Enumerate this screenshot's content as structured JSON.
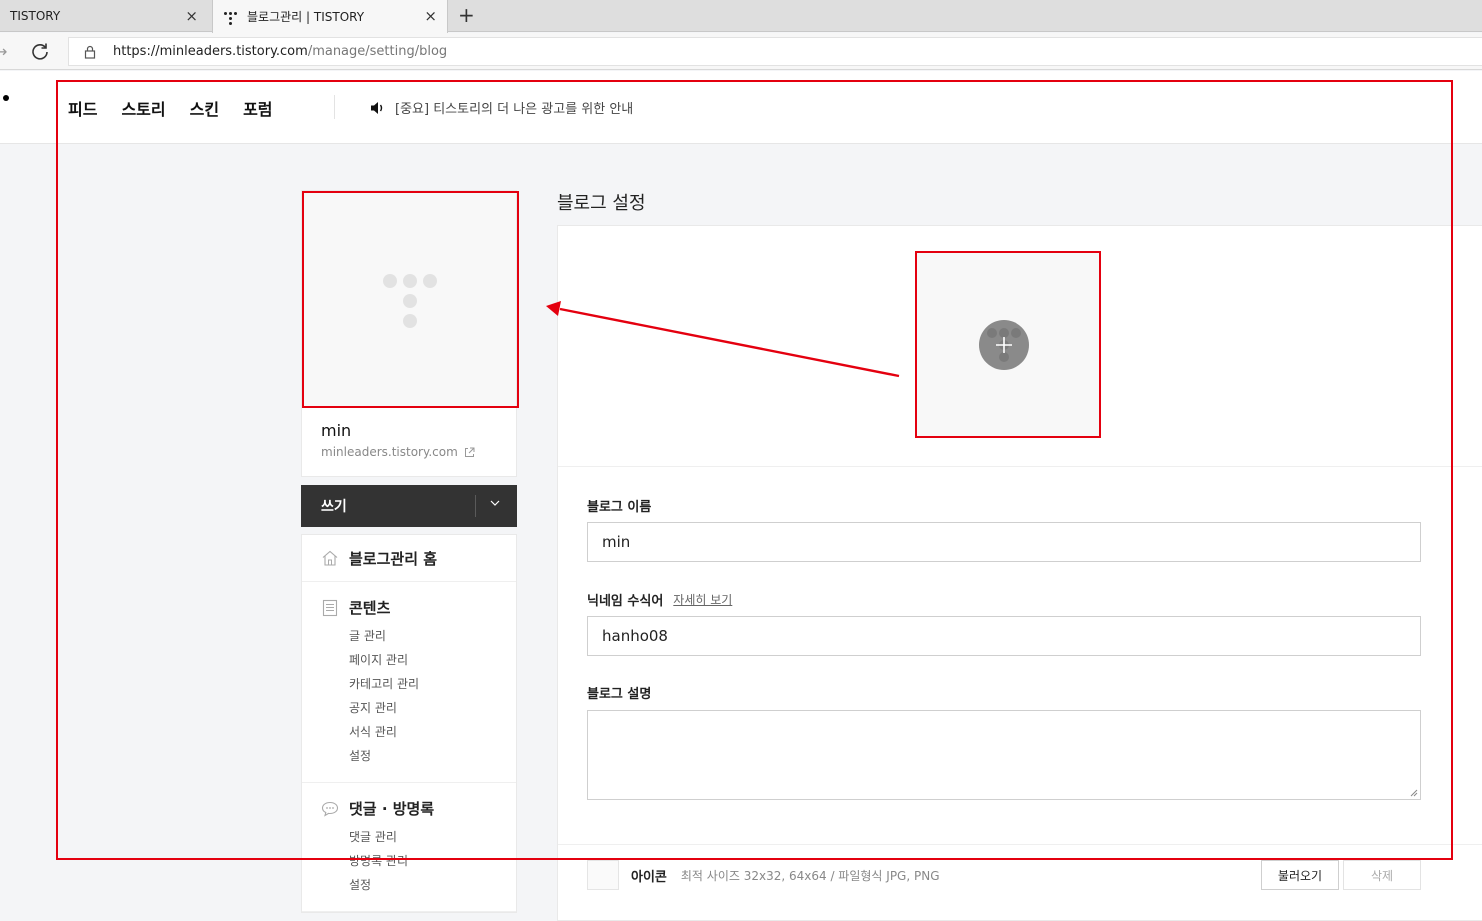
{
  "browser": {
    "tabs": [
      {
        "label": "TISTORY",
        "close": "×"
      },
      {
        "label": "블로그관리 | TISTORY",
        "close": "×"
      }
    ],
    "new_tab": "+",
    "url_host": "https://minleaders.tistory.com",
    "url_path": "/manage/setting/blog"
  },
  "nav": {
    "links": [
      "피드",
      "스토리",
      "스킨",
      "포럼"
    ],
    "notice": "[중요] 티스토리의 더 나은 광고를 위한 안내"
  },
  "sidebar": {
    "blog_name": "min",
    "blog_url": "minleaders.tistory.com",
    "write_label": "쓰기",
    "home_label": "블로그관리 홈",
    "contents": {
      "title": "콘텐츠",
      "items": [
        "글 관리",
        "페이지 관리",
        "카테고리 관리",
        "공지 관리",
        "서식 관리",
        "설정"
      ]
    },
    "comments": {
      "title": "댓글 · 방명록",
      "items": [
        "댓글 관리",
        "방명록 관리",
        "설정"
      ]
    }
  },
  "main": {
    "title": "블로그 설정",
    "blog_name_label": "블로그 이름",
    "blog_name_value": "min",
    "nickname_label": "닉네임 수식어",
    "nickname_more": "자세히 보기",
    "nickname_value": "hanho08",
    "description_label": "블로그 설명",
    "description_value": "",
    "icon_label": "아이콘",
    "icon_hint": "최적 사이즈 32x32, 64x64 / 파일형식 JPG, PNG",
    "load_button": "불러오기",
    "delete_button": "삭제"
  },
  "colors": {
    "annotation": "#e4000f",
    "write_button": "#333333"
  }
}
